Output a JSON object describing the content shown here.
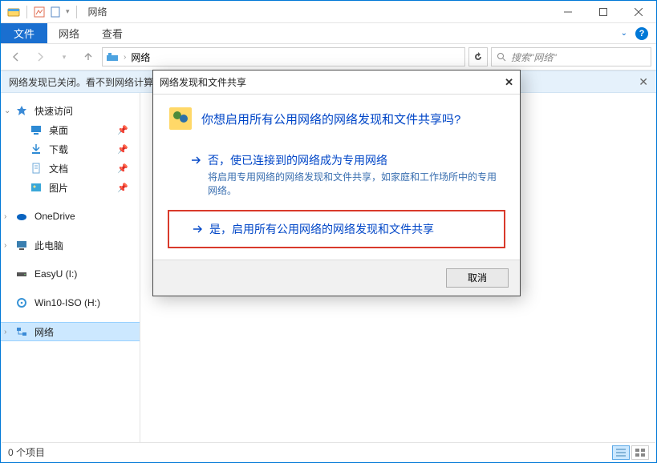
{
  "window": {
    "title": "网络"
  },
  "ribbon": {
    "file": "文件",
    "tab1": "网络",
    "tab2": "查看"
  },
  "breadcrumb": {
    "location": "网络"
  },
  "search": {
    "placeholder": "搜索\"网络\""
  },
  "notify": {
    "text": "网络发现已关闭。看不到网络计算机和设备。单击以更改..."
  },
  "sidebar": {
    "quick_access": "快速访问",
    "desktop": "桌面",
    "downloads": "下载",
    "documents": "文档",
    "pictures": "图片",
    "onedrive": "OneDrive",
    "thispc": "此电脑",
    "drive1": "EasyU (I:)",
    "drive2": "Win10-ISO (H:)",
    "network": "网络"
  },
  "status": {
    "text": "0 个项目"
  },
  "dialog": {
    "title": "网络发现和文件共享",
    "heading": "你想启用所有公用网络的网络发现和文件共享吗?",
    "option1_title": "否，使已连接到的网络成为专用网络",
    "option1_desc": "将启用专用网络的网络发现和文件共享，如家庭和工作场所中的专用网络。",
    "option2_title": "是，启用所有公用网络的网络发现和文件共享",
    "cancel": "取消"
  }
}
